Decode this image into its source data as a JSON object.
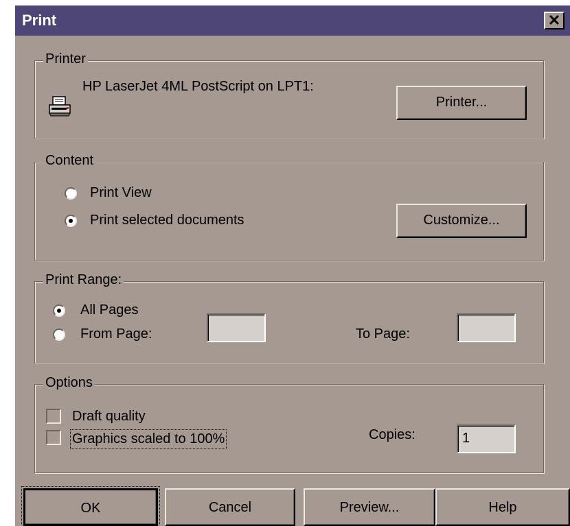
{
  "window": {
    "title": "Print",
    "close_label": "✕"
  },
  "printer_group": {
    "legend": "Printer",
    "printer_name": "HP LaserJet 4ML PostScript on LPT1:",
    "icon": "printer-icon",
    "printer_button": "Printer..."
  },
  "content_group": {
    "legend": "Content",
    "options": [
      {
        "label": "Print View",
        "selected": false
      },
      {
        "label": "Print selected documents",
        "selected": true
      }
    ],
    "customize_button": "Customize..."
  },
  "range_group": {
    "legend": "Print Range:",
    "all_pages_label": "All Pages",
    "all_pages_selected": true,
    "from_page_label": "From Page:",
    "from_page_selected": false,
    "from_page_value": "",
    "to_page_label": "To Page:",
    "to_page_value": ""
  },
  "options_group": {
    "legend": "Options",
    "draft_quality_label": "Draft quality",
    "draft_quality_checked": false,
    "graphics_scaled_label": "Graphics scaled to 100%",
    "graphics_scaled_checked": false,
    "copies_label": "Copies:",
    "copies_value": "1"
  },
  "buttons": {
    "ok": "OK",
    "cancel": "Cancel",
    "preview": "Preview...",
    "help": "Help"
  },
  "colors": {
    "dialog_bg": "#a69992",
    "titlebar_bg": "#4d4677",
    "field_bg": "#d6d0cc"
  }
}
